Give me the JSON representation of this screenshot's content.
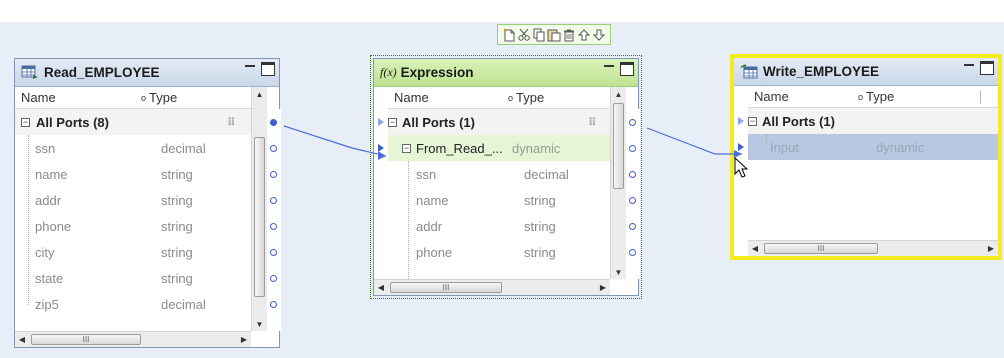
{
  "toolbar": {
    "icons": [
      "new-document-icon",
      "cut-icon",
      "copy-icon",
      "paste-icon",
      "delete-icon",
      "move-up-icon",
      "move-down-icon"
    ]
  },
  "read": {
    "title": "Read_EMPLOYEE",
    "columns": {
      "name": "Name",
      "type": "Type"
    },
    "group": "All Ports (8)",
    "ports": [
      {
        "name": "ssn",
        "type": "decimal"
      },
      {
        "name": "name",
        "type": "string"
      },
      {
        "name": "addr",
        "type": "string"
      },
      {
        "name": "phone",
        "type": "string"
      },
      {
        "name": "city",
        "type": "string"
      },
      {
        "name": "state",
        "type": "string"
      },
      {
        "name": "zip5",
        "type": "decimal"
      }
    ],
    "hscroll_grip": "III"
  },
  "expression": {
    "title": "Expression",
    "title_icon": "f(x)",
    "columns": {
      "name": "Name",
      "type": "Type"
    },
    "group": "All Ports (1)",
    "subgroup": {
      "name": "From_Read_...",
      "type": "dynamic"
    },
    "ports": [
      {
        "name": "ssn",
        "type": "decimal"
      },
      {
        "name": "name",
        "type": "string"
      },
      {
        "name": "addr",
        "type": "string"
      },
      {
        "name": "phone",
        "type": "string"
      }
    ],
    "hscroll_grip": "III"
  },
  "write": {
    "title": "Write_EMPLOYEE",
    "columns": {
      "name": "Name",
      "type": "Type"
    },
    "group": "All Ports (1)",
    "ports": [
      {
        "name": "Input",
        "type": "dynamic"
      }
    ],
    "hscroll_grip": "III"
  },
  "colors": {
    "canvas": "#e8eef7",
    "header": "#c9d7e8",
    "expr_header": "#c8eb9f",
    "link": "#4a6fd8",
    "selection_yellow": "#f4ec1c",
    "selected_row": "#b6c8e2"
  }
}
